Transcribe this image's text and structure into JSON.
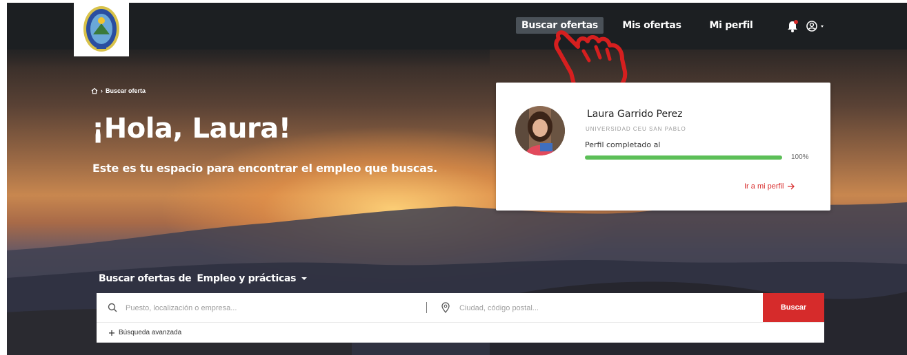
{
  "header": {
    "logo_alt": "",
    "nav": [
      {
        "label": "Buscar ofertas",
        "active": true
      },
      {
        "label": "Mis ofertas",
        "active": false
      },
      {
        "label": "Mi perfil",
        "active": false
      }
    ],
    "icons": [
      "bell-icon",
      "user-circle-icon",
      "caret-down-icon"
    ]
  },
  "breadcrumb": {
    "icon": "home-icon",
    "separator": "›",
    "current": "Buscar oferta"
  },
  "hero": {
    "title": "¡Hola, Laura!",
    "subtitle": "Este es tu espacio para encontrar el empleo que buscas."
  },
  "profile_card": {
    "name": "Laura Garrido Perez",
    "university": "UNIVERSIDAD CEU SAN PABLO",
    "progress_label": "Perfil completado al",
    "progress_value": 100,
    "progress_text": "100%",
    "link_label": "Ir a mi perfil"
  },
  "search": {
    "heading_prefix": "Buscar ofertas de",
    "heading_type": "Empleo y prácticas",
    "query_placeholder": "Puesto, localización o empresa...",
    "location_placeholder": "Ciudad, código postal...",
    "button_label": "Buscar",
    "advanced_label": "Búsqueda avanzada"
  },
  "colors": {
    "accent_red": "#d62b2b",
    "progress_green": "#5cbf58",
    "topbar": "#1c1f22"
  }
}
